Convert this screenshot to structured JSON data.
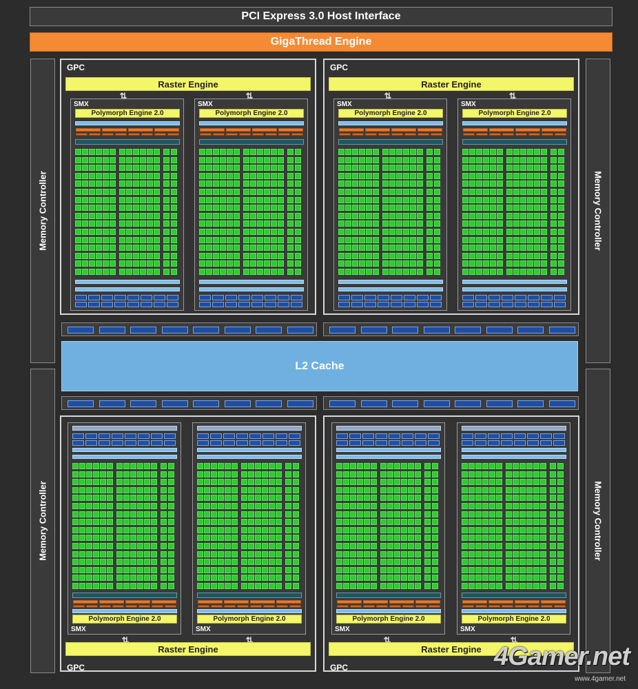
{
  "header": {
    "host_interface": "PCI Express 3.0 Host Interface",
    "giga_engine": "GigaThread Engine"
  },
  "memory_controller_label": "Memory Controller",
  "l2_label": "L2 Cache",
  "gpc_label": "GPC",
  "raster_label": "Raster Engine",
  "arrow_glyph": "⇅",
  "smx_label": "SMX",
  "polymorph_label": "Polymorph Engine 2.0",
  "watermark": {
    "logo": "4Gamer.net",
    "url": "www.4gamer.net"
  },
  "colors": {
    "background": "#2c2c2c",
    "giga_engine": "#f58a35",
    "raster": "#f4f66a",
    "l2_cache": "#6fb0e0",
    "core": "#2ecc2e",
    "load_store": "#1e4fa5",
    "cache_bar": "#7fbde8",
    "orange_unit": "#e77a2c"
  }
}
